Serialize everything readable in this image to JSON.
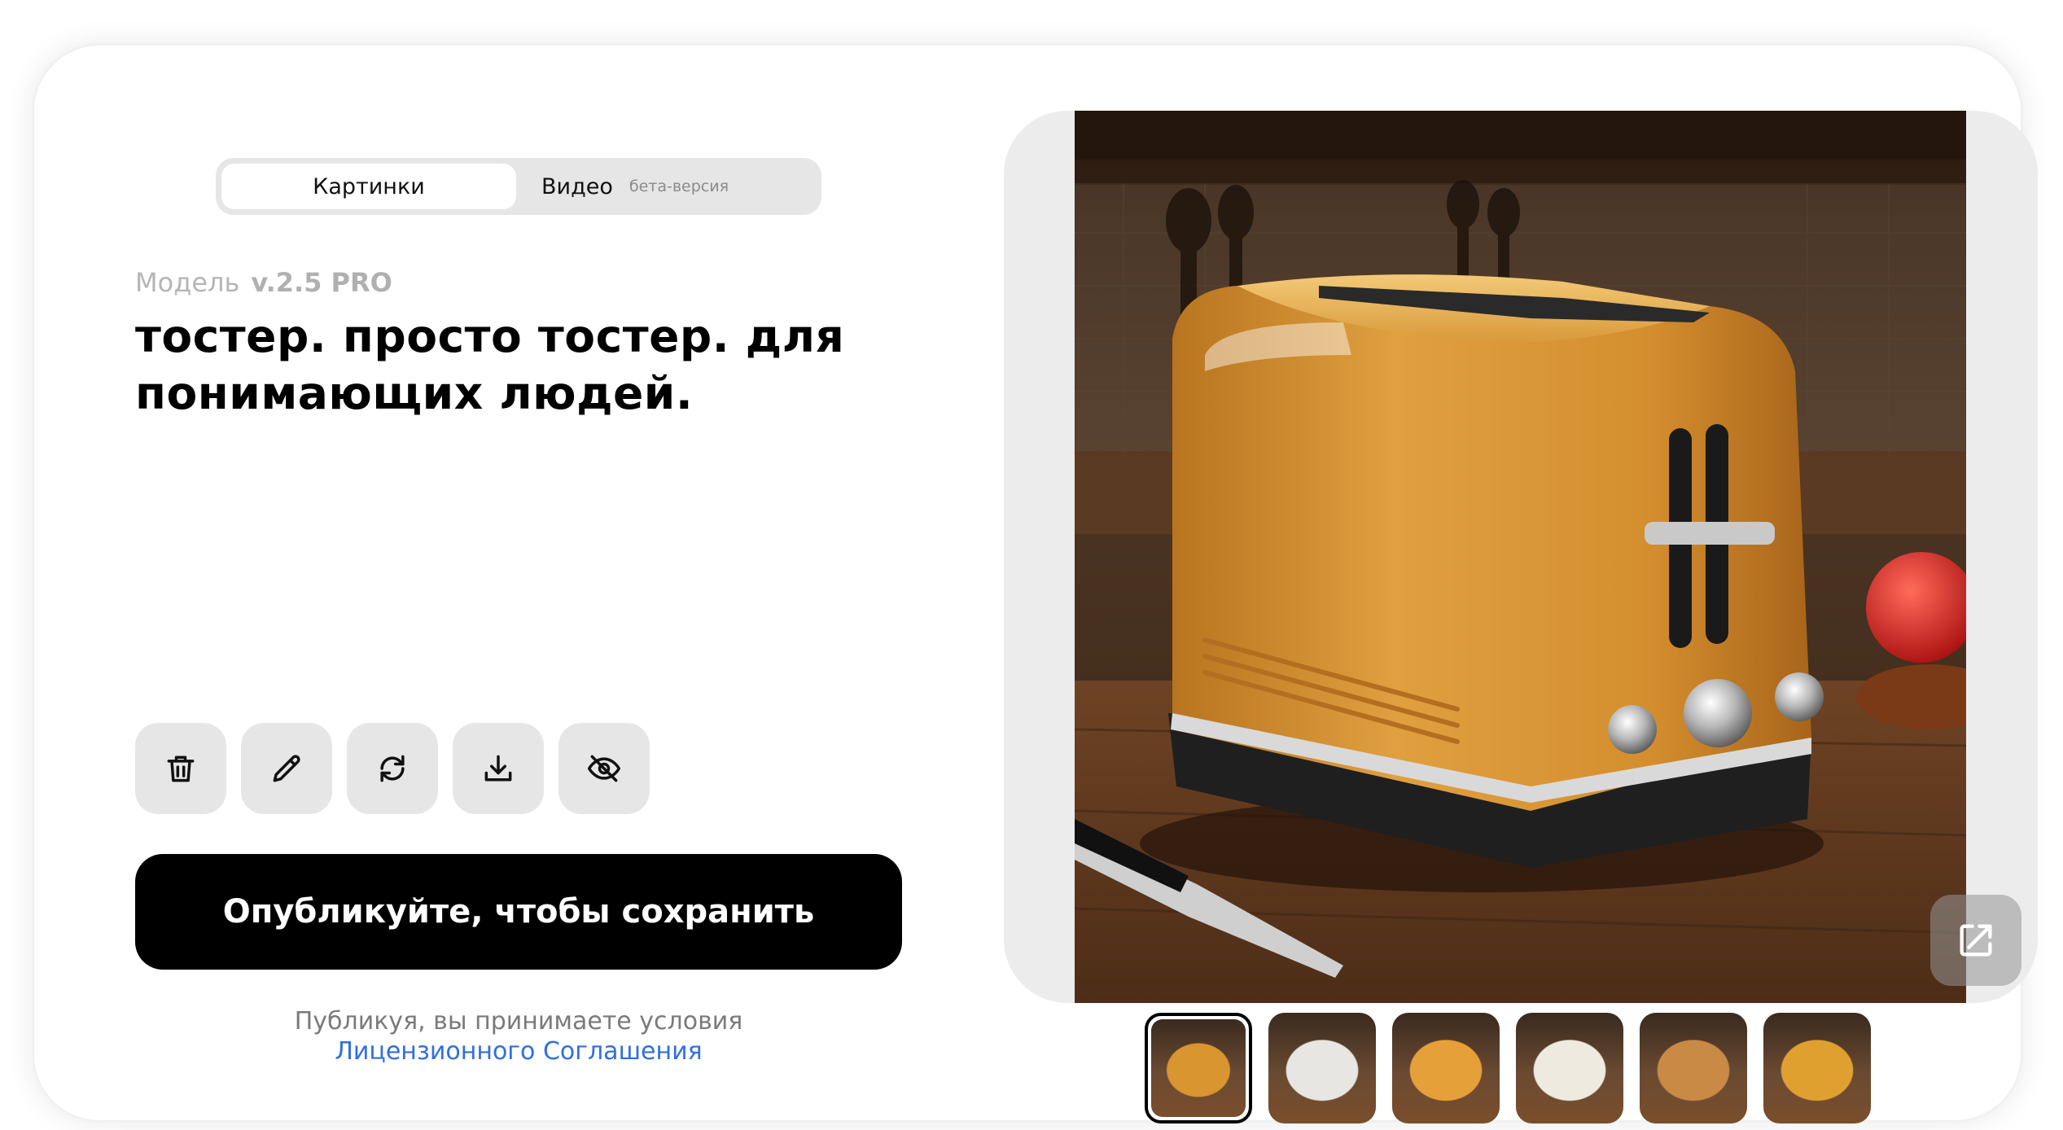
{
  "tabs": {
    "images_label": "Картинки",
    "video_label": "Видео",
    "video_badge": "бета-версия"
  },
  "model": {
    "label": "Модель",
    "version": "v.2.5 PRO"
  },
  "prompt_text": "тостер. просто тостер. для понимающих людей.",
  "actions": [
    {
      "icon": "trash-icon"
    },
    {
      "icon": "pencil-icon"
    },
    {
      "icon": "refresh-icon"
    },
    {
      "icon": "download-icon"
    },
    {
      "icon": "eye-off-icon"
    }
  ],
  "publish_button": "Опубликуйте, чтобы сохранить",
  "terms": {
    "text": "Публикуя, вы принимаете условия",
    "link": "Лицензионного Соглашения"
  },
  "colors": {
    "accent_link": "#2f6fe0",
    "button_bg": "#000000",
    "toaster": "#d9952f"
  },
  "thumbnails": [
    {
      "color": "#d9952f",
      "selected": true
    },
    {
      "color": "#e8e6e2",
      "selected": false
    },
    {
      "color": "#e6a03a",
      "selected": false
    },
    {
      "color": "#efeae0",
      "selected": false
    },
    {
      "color": "#c98a45",
      "selected": false
    },
    {
      "color": "#e0a030",
      "selected": false
    }
  ]
}
